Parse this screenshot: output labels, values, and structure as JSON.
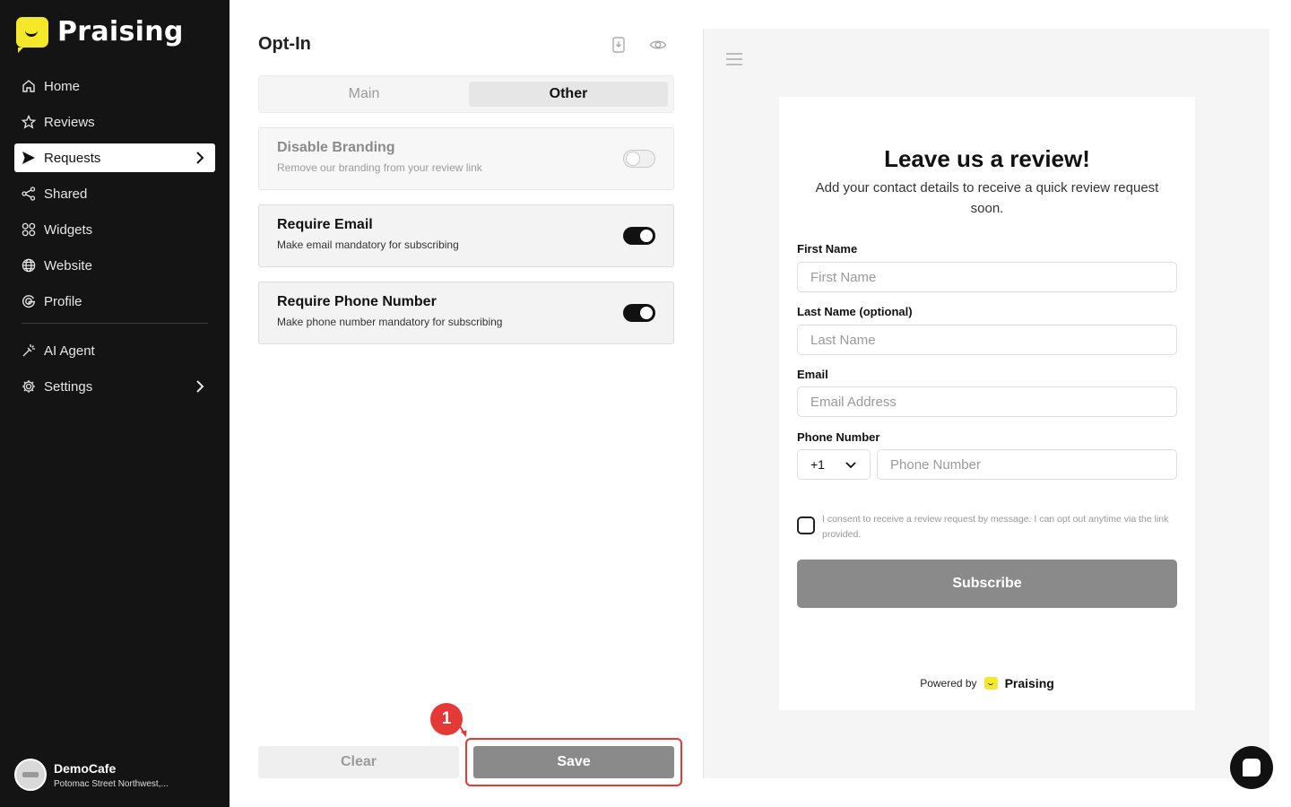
{
  "brand": {
    "name": "Praising",
    "accent": "#f5e82a"
  },
  "sidebar": {
    "items": [
      {
        "label": "Home",
        "icon": "home-icon"
      },
      {
        "label": "Reviews",
        "icon": "star-icon"
      },
      {
        "label": "Requests",
        "icon": "send-icon",
        "active": true
      },
      {
        "label": "Shared",
        "icon": "share-icon"
      },
      {
        "label": "Widgets",
        "icon": "widgets-icon"
      },
      {
        "label": "Website",
        "icon": "globe-icon"
      },
      {
        "label": "Profile",
        "icon": "google-icon"
      },
      {
        "label": "AI Agent",
        "icon": "sparkle-icon"
      },
      {
        "label": "Settings",
        "icon": "gear-icon"
      }
    ],
    "account": {
      "name": "DemoCafe",
      "address": "Potomac Street Northwest,..."
    }
  },
  "panel": {
    "title": "Opt-In",
    "tabs": [
      {
        "label": "Main"
      },
      {
        "label": "Other",
        "active": true
      }
    ],
    "settings": [
      {
        "title": "Disable Branding",
        "desc": "Remove our branding from your review link",
        "on": false,
        "disabled": true
      },
      {
        "title": "Require Email",
        "desc": "Make email mandatory for subscribing",
        "on": true
      },
      {
        "title": "Require Phone Number",
        "desc": "Make phone number mandatory for subscribing",
        "on": true
      }
    ],
    "clear_label": "Clear",
    "save_label": "Save",
    "step_badge": "1"
  },
  "preview": {
    "title": "Leave us a review!",
    "subtitle": "Add your contact details to receive a quick review request soon.",
    "fields": [
      {
        "label": "First Name",
        "placeholder": "First Name"
      },
      {
        "label": "Last Name (optional)",
        "placeholder": "Last Name"
      },
      {
        "label": "Email",
        "placeholder": "Email Address"
      },
      {
        "label": "Phone Number",
        "placeholder": "Phone Number"
      }
    ],
    "country_code": "+1",
    "consent": "I consent to receive a review request by message. I can opt out anytime via the link provided.",
    "subscribe_label": "Subscribe",
    "powered_by": "Powered by",
    "powered_brand": "Praising"
  }
}
